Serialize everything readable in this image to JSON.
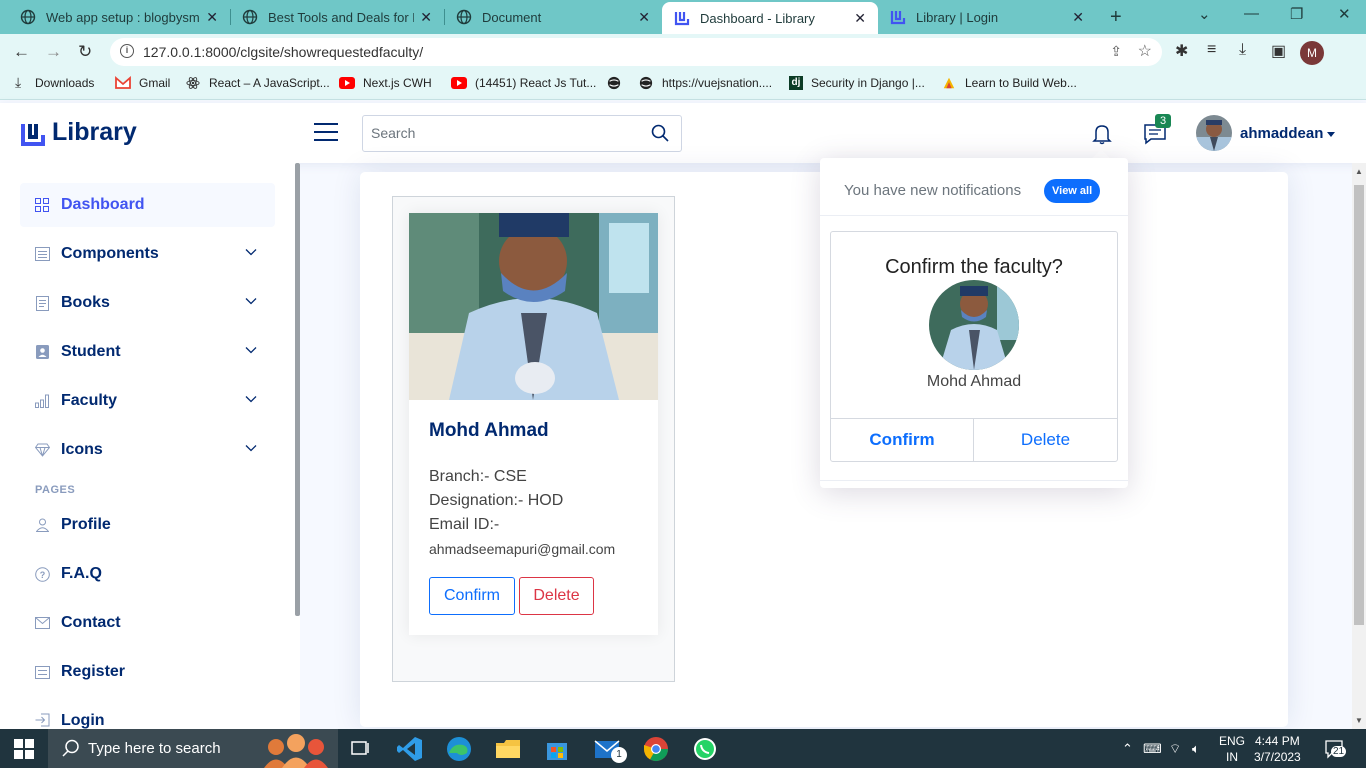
{
  "browser": {
    "tabs": [
      {
        "title": "Web app setup : blogbysma"
      },
      {
        "title": "Best Tools and Deals for Dev"
      },
      {
        "title": "Document"
      },
      {
        "title": "Dashboard - Library"
      },
      {
        "title": "Library | Login"
      }
    ],
    "url": "127.0.0.1:8000/clgsite/showrequestedfaculty/",
    "profile_initial": "M",
    "bookmarks": [
      {
        "label": "Downloads"
      },
      {
        "label": "Gmail"
      },
      {
        "label": "React – A JavaScript..."
      },
      {
        "label": "Next.js CWH"
      },
      {
        "label": "(14451) React Js Tut..."
      },
      {
        "label": ""
      },
      {
        "label": "https://vuejsnation...."
      },
      {
        "label": "Security in Django |..."
      },
      {
        "label": "Learn to Build Web..."
      }
    ]
  },
  "header": {
    "logo_text": "Library",
    "search_placeholder": "Search",
    "message_count": "3",
    "username": "ahmaddean"
  },
  "sidebar": {
    "items": [
      {
        "label": "Dashboard"
      },
      {
        "label": "Components"
      },
      {
        "label": "Books"
      },
      {
        "label": "Student"
      },
      {
        "label": "Faculty"
      },
      {
        "label": "Icons"
      }
    ],
    "pages_heading": "PAGES",
    "pages": [
      {
        "label": "Profile"
      },
      {
        "label": "F.A.Q"
      },
      {
        "label": "Contact"
      },
      {
        "label": "Register"
      },
      {
        "label": "Login"
      }
    ]
  },
  "faculty_card": {
    "name": "Mohd Ahmad",
    "branch": "Branch:- CSE",
    "designation": "Designation:- HOD",
    "email_label": "Email ID:-",
    "email": "ahmadseemapuri@gmail.com",
    "confirm_label": "Confirm",
    "delete_label": "Delete"
  },
  "notifications": {
    "header": "You have new notifications",
    "view_all": "View all",
    "confirm_title": "Confirm the faculty?",
    "name": "Mohd Ahmad",
    "confirm_label": "Confirm",
    "delete_label": "Delete"
  },
  "taskbar": {
    "search_placeholder": "Type here to search",
    "lang_top": "ENG",
    "lang_bottom": "IN",
    "time": "4:44 PM",
    "date": "3/7/2023",
    "notif_count": "21",
    "mail_badge": "1"
  },
  "colors": {
    "brand": "#012970",
    "accent": "#4154f1",
    "primary": "#0d6efd",
    "danger": "#dc3545",
    "tabbar": "#6fc7c7"
  }
}
